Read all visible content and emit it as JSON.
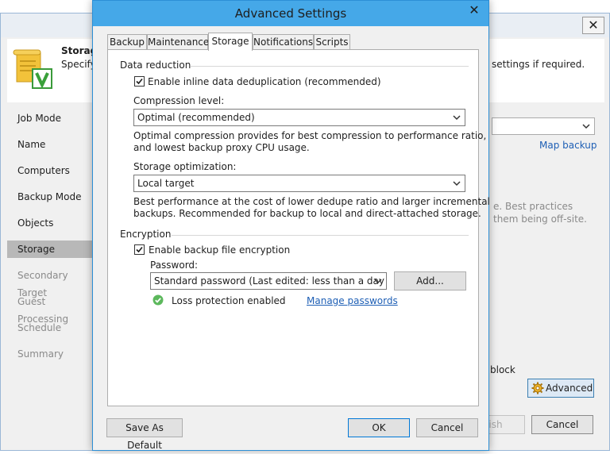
{
  "background_window": {
    "close_glyph": "✕",
    "header": {
      "title": "Storage",
      "description": "Specify",
      "description_tail": "settings if required.",
      "icon": "storage-scroll-icon"
    },
    "steps": [
      {
        "label": "Job Mode",
        "state": "done"
      },
      {
        "label": "Name",
        "state": "done"
      },
      {
        "label": "Computers",
        "state": "done"
      },
      {
        "label": "Backup Mode",
        "state": "done"
      },
      {
        "label": "Objects",
        "state": "done"
      },
      {
        "label": "Storage",
        "state": "active"
      },
      {
        "label": "Secondary Target",
        "state": "pending"
      },
      {
        "label": "Guest Processing",
        "state": "pending"
      },
      {
        "label": "Schedule",
        "state": "pending"
      },
      {
        "label": "Summary",
        "state": "pending"
      }
    ],
    "map_backup_link": "Map backup",
    "partial_text_1": "e. Best practices",
    "partial_text_2": "them being off-site.",
    "partial_text_3": "block",
    "advanced_button": "Advanced",
    "finish_button_partial": "ish",
    "cancel_button": "Cancel"
  },
  "dialog": {
    "title": "Advanced Settings",
    "close_glyph": "✕",
    "tabs": [
      {
        "label": "Backup",
        "active": false
      },
      {
        "label": "Maintenance",
        "active": false
      },
      {
        "label": "Storage",
        "active": true
      },
      {
        "label": "Notifications",
        "active": false
      },
      {
        "label": "Scripts",
        "active": false
      }
    ],
    "data_reduction": {
      "group_label": "Data reduction",
      "dedup_checkbox": {
        "label": "Enable inline data deduplication (recommended)",
        "checked": true
      },
      "compression_label": "Compression level:",
      "compression_value": "Optimal (recommended)",
      "compression_desc_1": "Optimal compression provides for best compression to performance ratio,",
      "compression_desc_2": "and lowest backup proxy CPU usage.",
      "optimization_label": "Storage optimization:",
      "optimization_value": "Local target",
      "optimization_desc_1": "Best performance at the cost of lower dedupe ratio and larger incremental",
      "optimization_desc_2": "backups. Recommended for backup to local and direct-attached storage."
    },
    "encryption": {
      "group_label": "Encryption",
      "encrypt_checkbox": {
        "label": "Enable backup file encryption",
        "checked": true
      },
      "password_label": "Password:",
      "password_value": "Standard password (Last edited: less than a day ago)",
      "add_button": "Add...",
      "loss_protection_text": "Loss protection enabled",
      "manage_passwords_link": "Manage passwords"
    },
    "footer": {
      "save_default_button": "Save As Default",
      "ok_button": "OK",
      "cancel_button": "Cancel"
    }
  },
  "colors": {
    "dialog_titlebar": "#45a8e8",
    "link": "#1e5fb5",
    "success_green": "#5cb85c"
  }
}
